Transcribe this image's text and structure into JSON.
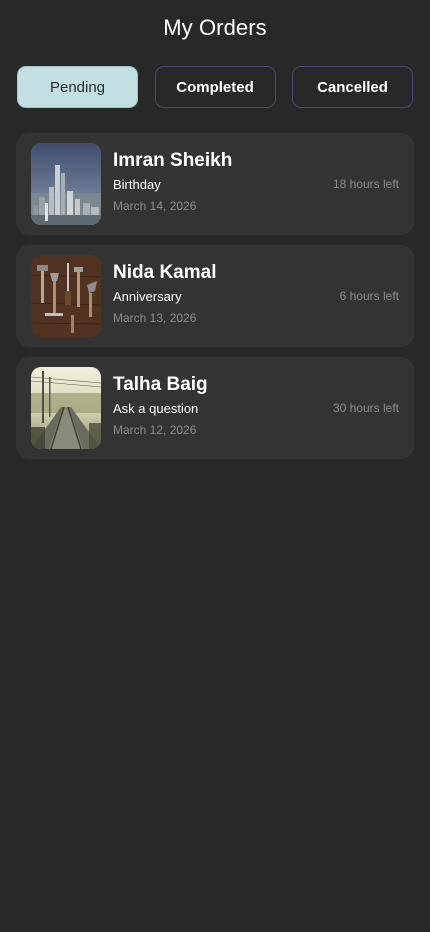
{
  "header": {
    "title": "My Orders"
  },
  "tabs": [
    {
      "label": "Pending",
      "active": true
    },
    {
      "label": "Completed",
      "active": false
    },
    {
      "label": "Cancelled",
      "active": false
    }
  ],
  "orders": [
    {
      "name": "Imran Sheikh",
      "occasion": "Birthday",
      "date": "March 14, 2026",
      "time_left": "18 hours left",
      "image": "city-skyline-photo"
    },
    {
      "name": "Nida Kamal",
      "occasion": "Anniversary",
      "date": "March 13, 2026",
      "time_left": "6 hours left",
      "image": "tools-on-wood-photo"
    },
    {
      "name": "Talha Baig",
      "occasion": "Ask a question",
      "date": "March 12, 2026",
      "time_left": "30 hours left",
      "image": "railway-track-photo"
    }
  ],
  "colors": {
    "background": "#282828",
    "card": "#333333",
    "tab_active_bg": "#c2e0e2",
    "tab_border": "#4a4a78",
    "muted_text": "#8d8d8d"
  }
}
